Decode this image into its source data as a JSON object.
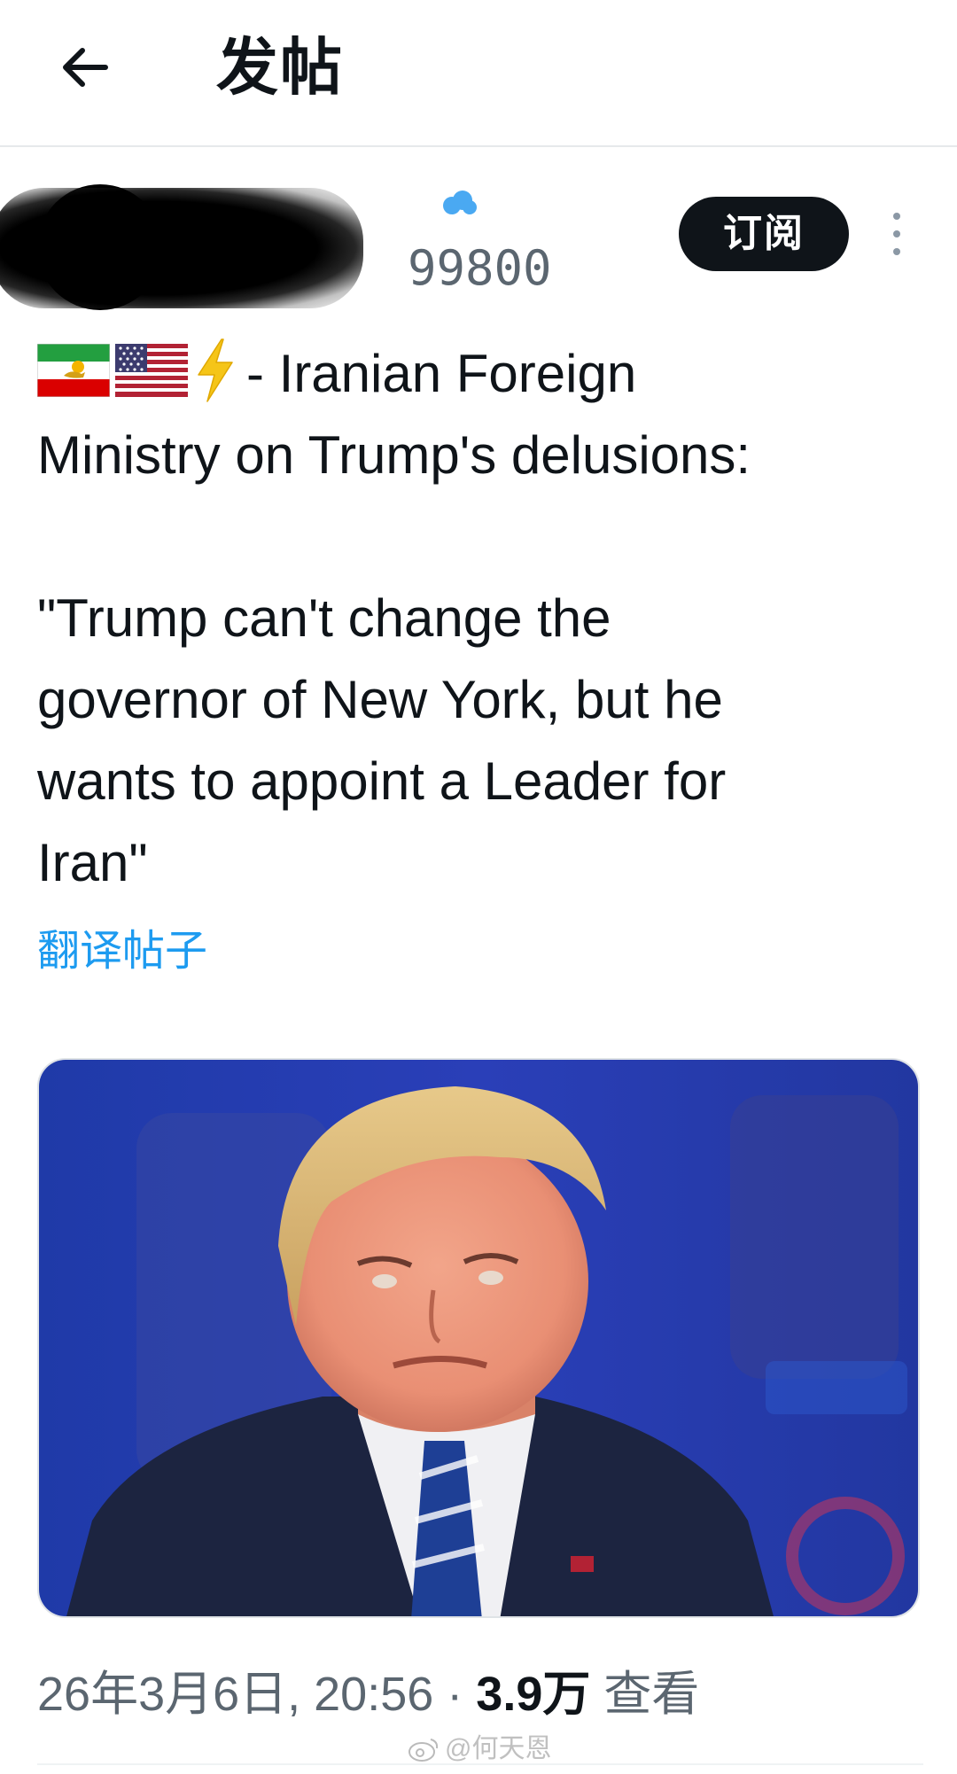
{
  "header": {
    "back_icon": "arrow-left-icon",
    "title": "发帖"
  },
  "author": {
    "handle_visible_fragment": "99800",
    "subscribe_label": "订阅",
    "more_icon": "vertical-dots-icon"
  },
  "post": {
    "lines": [
      "- Iranian Foreign",
      "Ministry on Trump's delusions:",
      "",
      "\"Trump can't change the",
      "governor of New York, but he",
      "wants to appoint a Leader for",
      "Iran\""
    ],
    "emoji": [
      "iran-lion-sun-flag",
      "us-flag",
      "lightning-bolt"
    ],
    "translate_label": "翻译帖子"
  },
  "media": {
    "description_icon": "photo-of-man-in-suit"
  },
  "meta": {
    "datetime": "26年3月6日, 20:56",
    "separator": "·",
    "views_count": "3.9万",
    "views_label": "查看"
  },
  "watermark": {
    "text": "@何天恩"
  },
  "colors": {
    "link": "#1d9bf0",
    "text": "#0f1419",
    "secondary": "#5b6670",
    "button_bg": "#0f1419"
  }
}
